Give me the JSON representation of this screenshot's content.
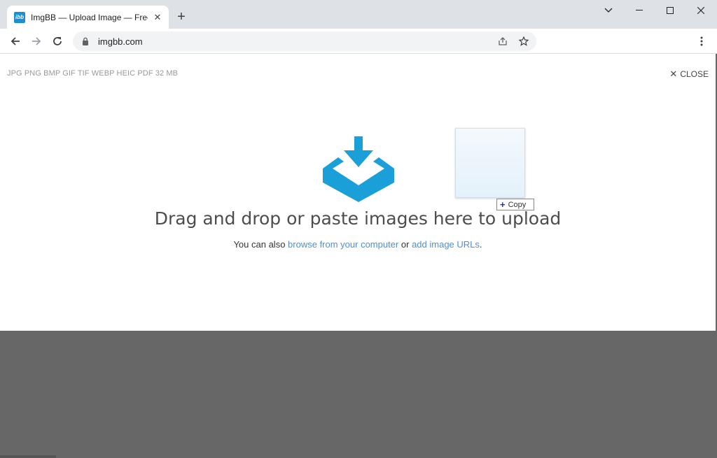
{
  "browser": {
    "tab_title": "ImgBB — Upload Image — Free",
    "favicon_text": "ibb",
    "url": "imgbb.com",
    "icons": {
      "back": "arrow-left-icon",
      "forward": "arrow-right-icon",
      "reload": "reload-icon",
      "lock": "lock-icon",
      "share": "share-icon",
      "bookmark": "star-icon",
      "menu": "kebab-menu-icon"
    }
  },
  "page": {
    "formats": "JPG PNG BMP GIF TIF WEBP HEIC PDF  32 MB",
    "close_label": "CLOSE",
    "headline": "Drag and drop or paste images here to upload",
    "sub_prefix": "You can also ",
    "browse_link": "browse from your computer",
    "sub_or": " or ",
    "urls_link": "add image URLs",
    "sub_suffix": ".",
    "copy_tooltip": "Copy",
    "accent_color": "#1a9fd9"
  }
}
